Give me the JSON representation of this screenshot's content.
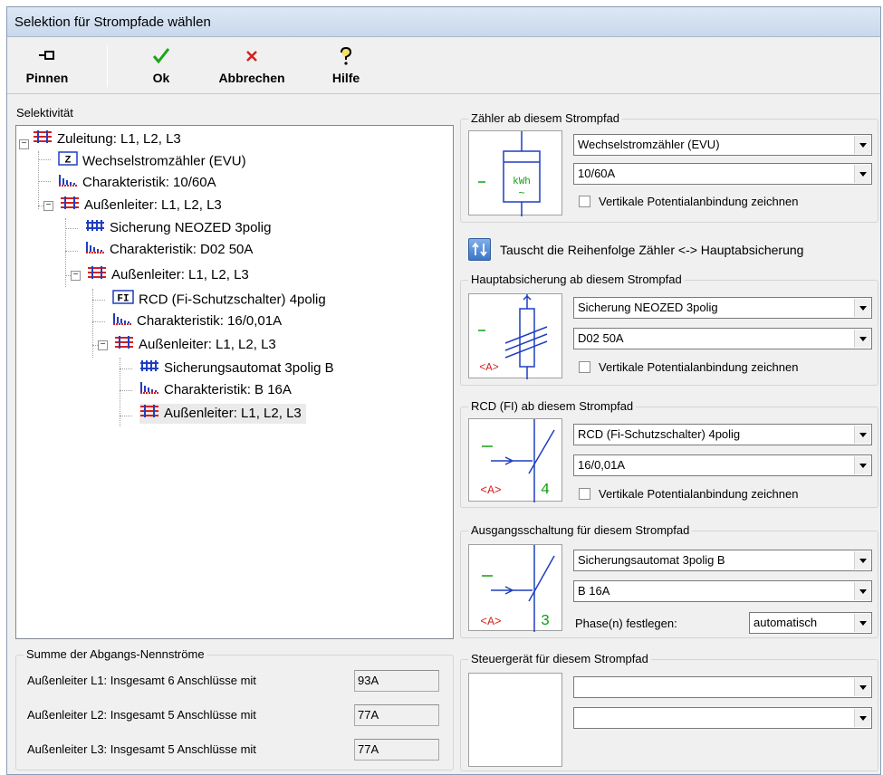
{
  "window": {
    "title": "Selektion für Strompfade wählen"
  },
  "toolbar": {
    "pin": "Pinnen",
    "ok": "Ok",
    "cancel": "Abbrechen",
    "help": "Hilfe"
  },
  "tree": {
    "label": "Selektivität",
    "items": [
      "Zuleitung: L1, L2, L3",
      "Wechselstromzähler (EVU)",
      "Charakteristik: 10/60A",
      "Außenleiter: L1, L2, L3",
      "Sicherung NEOZED 3polig",
      "Charakteristik: D02 50A",
      "Außenleiter: L1, L2, L3",
      "RCD (Fi-Schutzschalter) 4polig",
      "Charakteristik: 16/0,01A",
      "Außenleiter: L1, L2, L3",
      "Sicherungsautomat 3polig B",
      "Charakteristik: B 16A",
      "Außenleiter: L1, L2, L3"
    ],
    "icons": {
      "z": "Z",
      "fi": "FI"
    }
  },
  "meter": {
    "title": "Zähler ab diesem Strompfad",
    "type": "Wechselstromzähler (EVU)",
    "rating": "10/60A",
    "check": "Vertikale Potentialanbindung zeichnen",
    "kwh": "kWh",
    "tilde": "~"
  },
  "swap": {
    "label": "Tauscht die Reihenfolge Zähler <-> Hauptabsicherung"
  },
  "main_fuse": {
    "title": "Hauptabsicherung ab diesem Strompfad",
    "type": "Sicherung NEOZED 3polig",
    "rating": "D02 50A",
    "check": "Vertikale Potentialanbindung zeichnen",
    "sym": "<A>"
  },
  "rcd": {
    "title": "RCD (FI) ab diesem Strompfad",
    "type": "RCD (Fi-Schutzschalter) 4polig",
    "rating": "16/0,01A",
    "check": "Vertikale Potentialanbindung zeichnen",
    "sym": "<A>",
    "num": "4"
  },
  "output": {
    "title": "Ausgangsschaltung für diesem Strompfad",
    "type": "Sicherungsautomat 3polig B",
    "rating": "B 16A",
    "phase_label": "Phase(n) festlegen:",
    "phase_value": "automatisch",
    "sym": "<A>",
    "num": "3"
  },
  "control": {
    "title": "Steuergerät für diesem Strompfad",
    "value1": "",
    "value2": ""
  },
  "sum": {
    "title": "Summe der Abgangs-Nennströme",
    "rows": [
      {
        "label": "Außenleiter L1: Insgesamt 6 Anschlüsse mit",
        "value": "93A"
      },
      {
        "label": "Außenleiter L2: Insgesamt 5 Anschlüsse mit",
        "value": "77A"
      },
      {
        "label": "Außenleiter L3: Insgesamt 5 Anschlüsse mit",
        "value": "77A"
      }
    ]
  },
  "colors": {
    "accent_red": "#d42020",
    "ok_green": "#19a619",
    "link_blue": "#1f3fbf",
    "icon_green": "#12a012"
  }
}
